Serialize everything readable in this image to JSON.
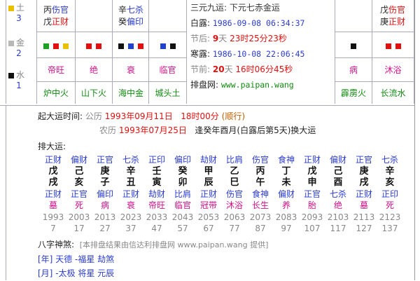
{
  "elements": [
    {
      "name": "土",
      "count": "3",
      "color": "#e8c000"
    },
    {
      "name": "金",
      "count": "2",
      "color": "#b8b8b8"
    },
    {
      "name": "水",
      "count": "1",
      "color": "#111111"
    }
  ],
  "pillars": [
    {
      "top_ss": "伤官",
      "top_ss2": "正财",
      "stem_shen": "丙",
      "stem_shen2": "戊",
      "status": "帝旺",
      "nayin": "炉中火",
      "squares": [
        "#20a020",
        "#e01010",
        "#e8c000"
      ]
    },
    {
      "top_ss": "",
      "top_ss2": "",
      "status": "绝",
      "nayin": "山下火",
      "squares": [
        "#e01010",
        "#e01010"
      ]
    },
    {
      "top_ss": "七杀",
      "top_ss2": "偏印",
      "stem_shen": "辛",
      "stem_shen2": "癸",
      "status": "衰",
      "nayin": "海中金",
      "squares": [
        "#111111",
        "#2040d0",
        "#e01010"
      ]
    },
    {
      "top_ss": "",
      "top_ss2": "",
      "status": "临官",
      "nayin": "城头土",
      "squares": [
        "#2040d0",
        "#111111"
      ]
    }
  ],
  "mid": {
    "title": "三元九运: 下元七赤金运",
    "bailu_label": "白露:",
    "bailu_time": "1986-09-08 06:34:37",
    "jq_before_label": "节后:",
    "jq_before_days": "9",
    "jq_before_rest": "23时25分23秒",
    "hanlu_label": "寒露:",
    "hanlu_time": "1986-10-08 22:06:45",
    "jq_after_label": "节前:",
    "jq_after_days": "20",
    "jq_after_rest": "16时06分45秒",
    "site_label": "排盘网:",
    "site_url": "www.paipan.wang"
  },
  "right": [
    {
      "top_ss": "伤官",
      "top_ss2": "正财",
      "stem_shen": "戊",
      "stem_shen2": "庚",
      "status": "病",
      "nayin": "霹雳火",
      "squares": [
        "#111111"
      ]
    },
    {
      "top_ss": "",
      "top_ss2": "",
      "status": "沐浴",
      "nayin": "长流水",
      "squares": [
        "#e01010",
        "#e01010"
      ]
    }
  ],
  "qiyun": {
    "label": "起大运时间:",
    "gongli_label": "公历",
    "gongli_date": "1993年09月11日",
    "gongli_hour": "18时00分",
    "shunni": "(顺行)",
    "nongli_label": "农历",
    "nongli_date": "1993年07月25日",
    "nongli_text": "逢癸年酉月(白露后第5天)换大运"
  },
  "dayun_label": "排大运:",
  "dayun": [
    {
      "ss": "正财",
      "g": "戊",
      "z": "戌",
      "zs": "正财",
      "st": "墓",
      "year": "1993",
      "age": "7"
    },
    {
      "ss": "偏财",
      "g": "己",
      "z": "亥",
      "zs": "正官",
      "st": "死",
      "year": "2003",
      "age": "17"
    },
    {
      "ss": "正官",
      "g": "庚",
      "z": "子",
      "zs": "偏印",
      "st": "病",
      "year": "2013",
      "age": "27"
    },
    {
      "ss": "七杀",
      "g": "辛",
      "z": "丑",
      "zs": "正财",
      "st": "衰",
      "year": "2023",
      "age": "37"
    },
    {
      "ss": "正印",
      "g": "壬",
      "z": "寅",
      "zs": "劫财",
      "st": "帝旺",
      "year": "2033",
      "age": "47"
    },
    {
      "ss": "偏印",
      "g": "癸",
      "z": "卯",
      "zs": "比肩",
      "st": "临官",
      "year": "2043",
      "age": "57"
    },
    {
      "ss": "劫财",
      "g": "甲",
      "z": "辰",
      "zs": "正财",
      "st": "冠带",
      "year": "2053",
      "age": "67"
    },
    {
      "ss": "比肩",
      "g": "乙",
      "z": "巳",
      "zs": "伤官",
      "st": "沐浴",
      "year": "2063",
      "age": "77"
    },
    {
      "ss": "伤官",
      "g": "丙",
      "z": "午",
      "zs": "食神",
      "st": "长生",
      "year": "2073",
      "age": "87"
    },
    {
      "ss": "食神",
      "g": "丁",
      "z": "未",
      "zs": "偏财",
      "st": "养",
      "year": "2083",
      "age": "97"
    },
    {
      "ss": "正财",
      "g": "戊",
      "z": "申",
      "zs": "正官",
      "st": "胎",
      "year": "2093",
      "age": "107"
    },
    {
      "ss": "偏财",
      "g": "己",
      "z": "酉",
      "zs": "七杀",
      "st": "绝",
      "year": "2103",
      "age": "117"
    },
    {
      "ss": "正官",
      "g": "庚",
      "z": "戌",
      "zs": "正财",
      "st": "墓",
      "year": "2113",
      "age": "127"
    },
    {
      "ss": "七杀",
      "g": "辛",
      "z": "亥",
      "zs": "正印",
      "st": "死",
      "year": "2123",
      "age": "137"
    }
  ],
  "shensha_label": "八字神煞:",
  "shensha_note": "[本排盘结果由信达利排盘网 www.paipan.wang 提供]",
  "shensha": [
    {
      "pillar": "[年]",
      "items": "天德 -福星 劫煞"
    },
    {
      "pillar": "[月]",
      "items": "-太极 将星 元辰"
    }
  ]
}
